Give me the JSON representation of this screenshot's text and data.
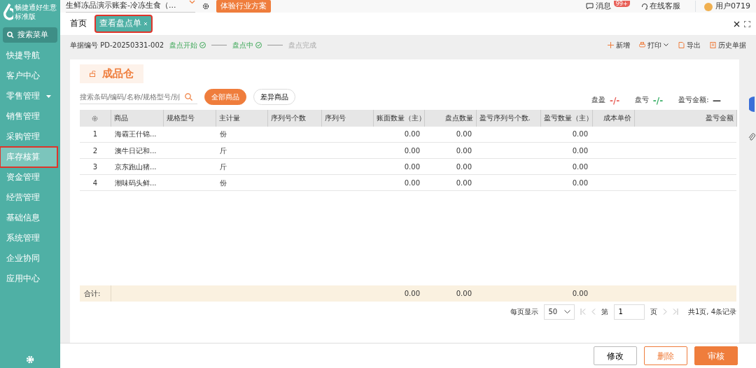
{
  "brand": {
    "name": "畅捷通好生意",
    "edition": "标准版"
  },
  "sidebar": {
    "search_label": "搜索菜单",
    "items": [
      {
        "label": "快捷导航",
        "selected": false,
        "has_caret": false,
        "annotated": false
      },
      {
        "label": "客户中心",
        "selected": false,
        "has_caret": false,
        "annotated": false
      },
      {
        "label": "零售管理",
        "selected": false,
        "has_caret": true,
        "annotated": false
      },
      {
        "label": "销售管理",
        "selected": false,
        "has_caret": false,
        "annotated": false
      },
      {
        "label": "采购管理",
        "selected": false,
        "has_caret": false,
        "annotated": false
      },
      {
        "label": "库存核算",
        "selected": true,
        "has_caret": false,
        "annotated": true
      },
      {
        "label": "资金管理",
        "selected": false,
        "has_caret": false,
        "annotated": false
      },
      {
        "label": "经营管理",
        "selected": false,
        "has_caret": false,
        "annotated": false
      },
      {
        "label": "基础信息",
        "selected": false,
        "has_caret": false,
        "annotated": false
      },
      {
        "label": "系统管理",
        "selected": false,
        "has_caret": false,
        "annotated": false
      },
      {
        "label": "企业协同",
        "selected": false,
        "has_caret": false,
        "annotated": false
      },
      {
        "label": "应用中心",
        "selected": false,
        "has_caret": false,
        "annotated": false
      }
    ]
  },
  "topbar": {
    "account": "生鲜冻品演示账套-冷冻生食（...",
    "promo": "体验行业方案",
    "messages": "消息",
    "message_badge": "99+",
    "service": "在线客服",
    "user": "用户0719"
  },
  "tabs": [
    {
      "label": "首页",
      "selected": false,
      "closable": false,
      "annotated": false
    },
    {
      "label": "查看盘点单",
      "selected": true,
      "closable": true,
      "annotated": true
    }
  ],
  "document": {
    "number_label": "单据编号",
    "number": "PD-20250331-002",
    "steps": [
      {
        "label": "盘点开始",
        "done": true
      },
      {
        "label": "盘点中",
        "done": true
      },
      {
        "label": "盘点完成",
        "done": false
      }
    ]
  },
  "toolbar": [
    {
      "kind": "add",
      "label": "新增",
      "has_caret": false
    },
    {
      "kind": "print",
      "label": "打印",
      "has_caret": true
    },
    {
      "kind": "export",
      "label": "导出",
      "has_caret": false
    },
    {
      "kind": "history",
      "label": "历史单据",
      "has_caret": false
    }
  ],
  "warehouse": "成品仓",
  "search": {
    "placeholder": "搜索条码/编码/名称/规格型号/别"
  },
  "filters": [
    {
      "label": "全部商品",
      "selected": true
    },
    {
      "label": "差异商品",
      "selected": false
    }
  ],
  "summary": [
    {
      "label": "盘盈",
      "value": "-/-",
      "color": "#e8615a"
    },
    {
      "label": "盘亏",
      "value": "-/-",
      "color": "#3db06a"
    },
    {
      "label": "盈亏金额:",
      "value": "—",
      "color": "#333333"
    }
  ],
  "table": {
    "columns": [
      null,
      "商品",
      "规格型号",
      "主计量",
      "序列号个数",
      "序列号",
      "账面数量（主）",
      "盘点数量",
      "盈亏序列号个数.",
      "盈亏数量（主）",
      "成本单价",
      "盈亏金额"
    ],
    "rows": [
      [
        "1",
        "海霸王什锦...",
        null,
        "份",
        null,
        null,
        "0.00",
        "0.00",
        null,
        "0.00",
        null,
        null
      ],
      [
        "2",
        "澳牛日记和...",
        null,
        "斤",
        null,
        null,
        "0.00",
        "0.00",
        null,
        "0.00",
        null,
        null
      ],
      [
        "3",
        "京东跑山猪...",
        null,
        "斤",
        null,
        null,
        "0.00",
        "0.00",
        null,
        "0.00",
        null,
        null
      ],
      [
        "4",
        "潮味码头鲜...",
        null,
        "份",
        null,
        null,
        "0.00",
        "0.00",
        null,
        "0.00",
        null,
        null
      ]
    ],
    "total_label": "合计:",
    "totals": {
      "column_6": "0.00",
      "column_7": "0.00",
      "column_9": "0.00"
    }
  },
  "pagination": {
    "per_page_label": "每页显示",
    "per_page": "50",
    "page_prefix": "第",
    "page": "1",
    "page_suffix": "页",
    "summary": "共1页, 4条记录"
  },
  "actions": [
    {
      "kind": "secondary",
      "label": "修改"
    },
    {
      "kind": "outline",
      "label": "删除"
    },
    {
      "kind": "primary",
      "label": "审核"
    }
  ]
}
